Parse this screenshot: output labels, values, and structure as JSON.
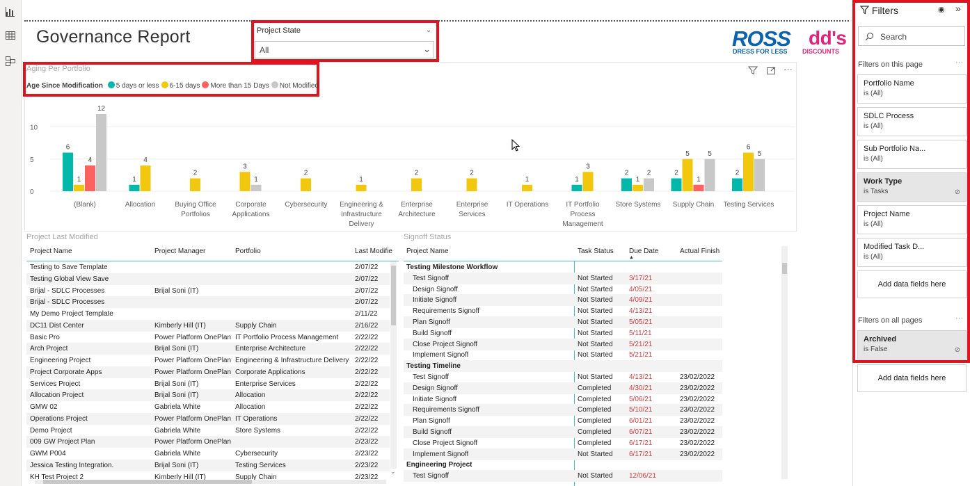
{
  "report": {
    "title": "Governance Report"
  },
  "slicer": {
    "label": "Project State",
    "value": "All"
  },
  "logos": {
    "ross": "ROSS",
    "ross_sub": "DRESS FOR LESS",
    "dds": "dd's",
    "dds_sub": "DISCOUNTS"
  },
  "chart_data": {
    "type": "bar",
    "title": "Aging Per Portfolio",
    "legend_title": "Age Since Modification",
    "legend_position": "top-left",
    "categories": [
      "(Blank)",
      "Allocation",
      "Buying Office Portfolios",
      "Corporate Applications",
      "Cybersecurity",
      "Engineering & Infrastructure Delivery",
      "Enterprise Architecture",
      "Enterprise Services",
      "IT Operations",
      "IT Portfolio Process Management",
      "Store Systems",
      "Supply Chain",
      "Testing Services"
    ],
    "category_lines": [
      [
        "(Blank)"
      ],
      [
        "Allocation"
      ],
      [
        "Buying Office",
        "Portfolios"
      ],
      [
        "Corporate",
        "Applications"
      ],
      [
        "Cybersecurity"
      ],
      [
        "Engineering &",
        "Infrastructure",
        "Delivery"
      ],
      [
        "Enterprise",
        "Architecture"
      ],
      [
        "Enterprise",
        "Services"
      ],
      [
        "IT Operations"
      ],
      [
        "IT Portfolio",
        "Process",
        "Management"
      ],
      [
        "Store Systems"
      ],
      [
        "Supply Chain"
      ],
      [
        "Testing Services"
      ]
    ],
    "series": [
      {
        "name": "5 days or less",
        "color": "#01b8aa",
        "values": [
          6,
          1,
          null,
          null,
          null,
          null,
          null,
          null,
          null,
          1,
          2,
          2,
          2
        ]
      },
      {
        "name": "6-15 days",
        "color": "#f2c80f",
        "values": [
          1,
          4,
          2,
          3,
          2,
          1,
          2,
          2,
          1,
          3,
          1,
          5,
          6
        ]
      },
      {
        "name": "More than 15 Days",
        "color": "#fd625e",
        "values": [
          4,
          null,
          null,
          null,
          null,
          null,
          null,
          null,
          null,
          null,
          null,
          1,
          null
        ]
      },
      {
        "name": "Not Modified",
        "color": "#c8c8c8",
        "values": [
          12,
          null,
          null,
          1,
          null,
          null,
          null,
          null,
          null,
          null,
          2,
          5,
          5
        ]
      }
    ],
    "yticks": [
      0,
      5,
      10
    ],
    "ylim": [
      0,
      13
    ],
    "grid": true
  },
  "project_table": {
    "title": "Project Last Modified",
    "columns": [
      "Project Name",
      "Project Manager",
      "Portfolio",
      "Last Modifie"
    ],
    "rows": [
      [
        "Testing to Save Template",
        "",
        "",
        "2/07/22"
      ],
      [
        "Testing Global View Save",
        "",
        "",
        "2/07/22"
      ],
      [
        "Brijal - SDLC Processes",
        "Brijal Soni (IT)",
        "",
        "2/07/22"
      ],
      [
        "Brijal - SDLC Processes",
        "",
        "",
        "2/07/22"
      ],
      [
        "My Demo Project Template",
        "",
        "",
        "2/11/22"
      ],
      [
        "DC11 Dist Center",
        "Kimberly Hill (IT)",
        "Supply Chain",
        "2/16/22"
      ],
      [
        "Basic Pro",
        "Power Platform OnePlan",
        "IT Portfolio Process Management",
        "2/22/22"
      ],
      [
        "Arch Project",
        "Brijal Soni (IT)",
        "Enterprise Architecture",
        "2/22/22"
      ],
      [
        "Engineering Project",
        "Power Platform OnePlan",
        "Engineering & Infrastructure Delivery",
        "2/22/22"
      ],
      [
        "Project Corporate Apps",
        "Power Platform OnePlan",
        "Corporate Applications",
        "2/22/22"
      ],
      [
        "Services Project",
        "Brijal Soni (IT)",
        "Enterprise Services",
        "2/22/22"
      ],
      [
        "Allocation Project",
        "Brijal Soni (IT)",
        "Allocation",
        "2/22/22"
      ],
      [
        "GMW 02",
        "Gabriela White",
        "Allocation",
        "2/22/22"
      ],
      [
        "Operations Project",
        "Power Platform OnePlan",
        "IT Operations",
        "2/22/22"
      ],
      [
        "Demo Project",
        "Gabriela White",
        "Store Systems",
        "2/22/22"
      ],
      [
        "009 GW Project Plan",
        "Power Platform OnePlan",
        "",
        "2/23/22"
      ],
      [
        "GWM P004",
        "Gabriela White",
        "Cybersecurity",
        "2/23/22"
      ],
      [
        "Jessica Testing Integration.",
        "Brijal Soni (IT)",
        "Testing Services",
        "2/23/22"
      ],
      [
        "KH Test Project 2",
        "Kimberly Hill (IT)",
        "Supply Chain",
        "2/23/22"
      ]
    ]
  },
  "signoff_table": {
    "title": "Signoff Status",
    "columns": [
      "Project Name",
      "Task Status",
      "Due Date",
      "Actual Finish"
    ],
    "rows": [
      {
        "group": true,
        "name": "Testing Milestone Workflow"
      },
      {
        "name": "Test Signoff",
        "status": "Not Started",
        "due": "3/17/21",
        "finish": ""
      },
      {
        "name": "Design Signoff",
        "status": "Not Started",
        "due": "4/05/21",
        "finish": ""
      },
      {
        "name": "Initiate Signoff",
        "status": "Not Started",
        "due": "4/09/21",
        "finish": ""
      },
      {
        "name": "Requirements Signoff",
        "status": "Not Started",
        "due": "4/13/21",
        "finish": ""
      },
      {
        "name": "Plan Signoff",
        "status": "Not Started",
        "due": "5/05/21",
        "finish": ""
      },
      {
        "name": "Build Signoff",
        "status": "Not Started",
        "due": "5/11/21",
        "finish": ""
      },
      {
        "name": "Close Project Signoff",
        "status": "Not Started",
        "due": "5/21/21",
        "finish": ""
      },
      {
        "name": "Implement Signoff",
        "status": "Not Started",
        "due": "5/21/21",
        "finish": ""
      },
      {
        "group": true,
        "name": "Testing Timeline"
      },
      {
        "name": "Test Signoff",
        "status": "Not Started",
        "due": "4/13/21",
        "finish": "23/02/2022"
      },
      {
        "name": "Design Signoff",
        "status": "Completed",
        "due": "4/30/21",
        "finish": "23/02/2022"
      },
      {
        "name": "Initiate Signoff",
        "status": "Completed",
        "due": "5/06/21",
        "finish": "23/02/2022"
      },
      {
        "name": "Requirements Signoff",
        "status": "Completed",
        "due": "5/10/21",
        "finish": "23/02/2022"
      },
      {
        "name": "Plan Signoff",
        "status": "Completed",
        "due": "6/01/21",
        "finish": "23/02/2022"
      },
      {
        "name": "Build Signoff",
        "status": "Completed",
        "due": "6/07/21",
        "finish": "23/02/2022"
      },
      {
        "name": "Close Project Signoff",
        "status": "Completed",
        "due": "6/17/21",
        "finish": "23/02/2022"
      },
      {
        "name": "Implement Signoff",
        "status": "Not Started",
        "due": "6/17/21",
        "finish": "23/02/2022"
      },
      {
        "group": true,
        "name": "Engineering Project"
      },
      {
        "name": "Test Signoff",
        "status": "Not Started",
        "due": "12/06/21",
        "finish": ""
      }
    ]
  },
  "filters": {
    "title": "Filters",
    "search_placeholder": "Search",
    "on_page_label": "Filters on this page",
    "all_pages_label": "Filters on all pages",
    "add_label": "Add data fields here",
    "page_filters": [
      {
        "name": "Portfolio Name",
        "value": "is (All)",
        "active": false
      },
      {
        "name": "SDLC Process",
        "value": "is (All)",
        "active": false
      },
      {
        "name": "Sub Portfolio Na...",
        "value": "is (All)",
        "active": false
      },
      {
        "name": "Work Type",
        "value": "is Tasks",
        "active": true
      },
      {
        "name": "Project Name",
        "value": "is (All)",
        "active": false
      },
      {
        "name": "Modified Task D...",
        "value": "is (All)",
        "active": false
      }
    ],
    "all_filters": [
      {
        "name": "Archived",
        "value": "is False",
        "active": true
      }
    ]
  },
  "icons": {
    "rail": [
      "report-view-icon",
      "data-view-icon",
      "model-view-icon"
    ],
    "visual": [
      "filter-icon",
      "focus-mode-icon",
      "more-options-icon"
    ],
    "pane": [
      "filter-funnel-icon",
      "eye-icon",
      "collapse-icon"
    ]
  }
}
